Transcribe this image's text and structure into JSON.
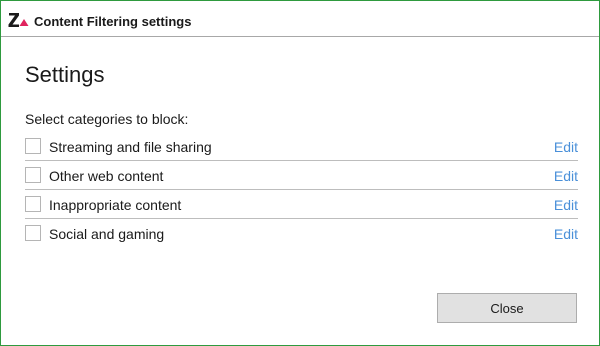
{
  "window": {
    "title": "Content Filtering settings",
    "logo_icon": "zonealarm-logo-icon",
    "border_color": "#2e9a3e"
  },
  "main": {
    "heading": "Settings",
    "subheading": "Select categories to block:",
    "categories": [
      {
        "label": "Streaming and file sharing",
        "checked": false,
        "edit_label": "Edit"
      },
      {
        "label": "Other web content",
        "checked": false,
        "edit_label": "Edit"
      },
      {
        "label": "Inappropriate content",
        "checked": false,
        "edit_label": "Edit"
      },
      {
        "label": "Social and gaming",
        "checked": false,
        "edit_label": "Edit"
      }
    ],
    "link_color": "#4a90d9"
  },
  "footer": {
    "close_label": "Close"
  }
}
